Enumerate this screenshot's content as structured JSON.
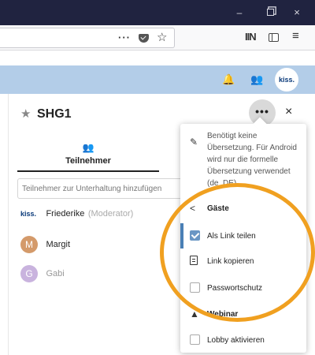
{
  "browser": {
    "window_controls": {
      "minimize": "–",
      "close": "×"
    },
    "url_actions": {
      "more": "···",
      "bookmark": "☆"
    },
    "toolbar": {
      "library": "IIN",
      "menu": "≡"
    }
  },
  "app": {
    "header": {
      "bell": "🔔",
      "contacts": "👥",
      "avatar_label": "kiss."
    }
  },
  "room": {
    "title": "SHG1",
    "favorite_icon": "★",
    "more_label": "•••",
    "close_label": "×"
  },
  "tabs": {
    "participants": {
      "icon": "👥",
      "label": "Teilnehmer"
    }
  },
  "participants": {
    "search_placeholder": "Teilnehmer zur Unterhaltung hinzufügen",
    "items": [
      {
        "logo": "kiss.",
        "name": "Friederike",
        "role": "(Moderator)"
      },
      {
        "avatar": "M",
        "name": "Margit",
        "color": "#d49a6a"
      },
      {
        "avatar": "G",
        "name": "Gabi",
        "color": "#c9b3de"
      }
    ]
  },
  "menu": {
    "translation_note": "Benötigt keine Übersetzung. Für Android wird nur die formelle Übersetzung verwendet (de_DE).",
    "guests_caption": "Gäste",
    "share_link": "Als Link teilen",
    "copy_link": "Link kopieren",
    "password": "Passwortschutz",
    "webinar_caption": "Webinar",
    "lobby": "Lobby aktivieren",
    "share_link_checked": true
  },
  "colors": {
    "titlebar": "#202340",
    "app_header": "#b3cde8",
    "accent": "#4a7fb5",
    "highlight": "#f0a020"
  }
}
